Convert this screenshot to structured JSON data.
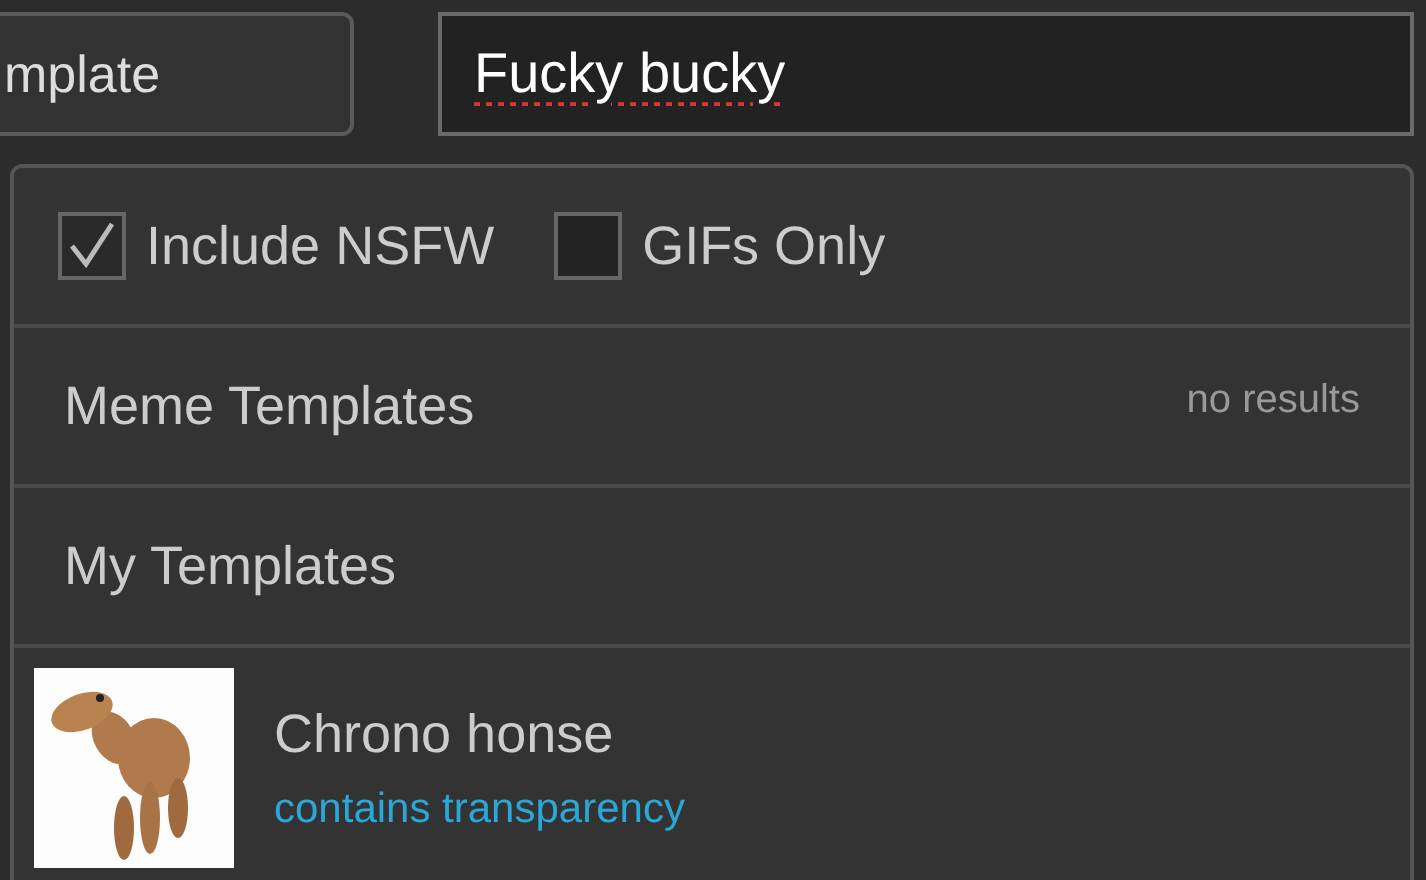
{
  "upload_button": {
    "label": "mplate"
  },
  "search": {
    "value": "Fucky bucky",
    "misspelled": true
  },
  "filters": [
    {
      "label": "Include NSFW",
      "checked": true
    },
    {
      "label": "GIFs Only",
      "checked": false
    }
  ],
  "sections": [
    {
      "title": "Meme Templates",
      "note": "no results"
    },
    {
      "title": "My Templates"
    }
  ],
  "results": [
    {
      "title": "Chrono honse",
      "subtitle": "contains transparency"
    }
  ]
}
